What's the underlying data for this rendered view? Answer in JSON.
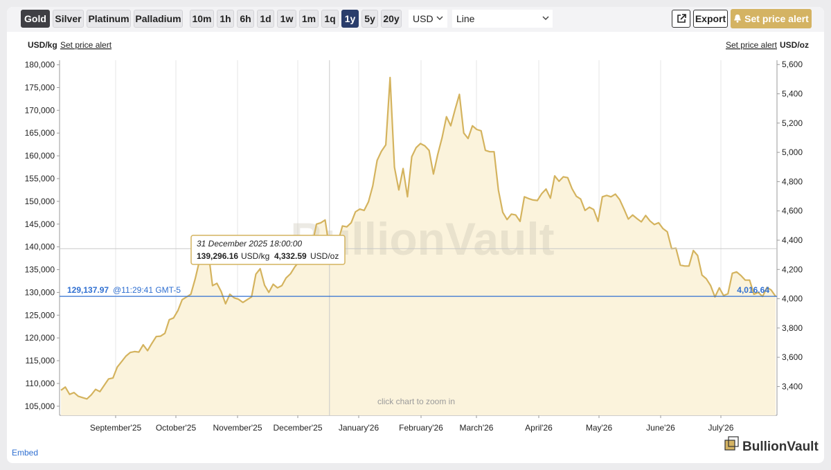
{
  "toolbar": {
    "metals": [
      "Gold",
      "Silver",
      "Platinum",
      "Palladium"
    ],
    "active_metal": "Gold",
    "ranges": [
      "10m",
      "1h",
      "6h",
      "1d",
      "1w",
      "1m",
      "1q",
      "1y",
      "5y",
      "20y"
    ],
    "active_range": "1y",
    "currency": "USD",
    "chart_style": "Line",
    "export_label": "Export",
    "alert_label": "Set price alert"
  },
  "left_unit": "USD/kg",
  "right_unit": "USD/oz",
  "set_alert_link": "Set price alert",
  "watermark": "BullionVault",
  "zoom_hint": "click chart to zoom in",
  "tooltip": {
    "date": "31 December 2025 18:00:00",
    "kg": "139,296.16",
    "kg_unit": "USD/kg",
    "oz": "4,332.59",
    "oz_unit": "USD/oz"
  },
  "current": {
    "kg": "129,137.97",
    "time": "@11:29:41 GMT-5",
    "oz": "4,016.64"
  },
  "embed_label": "Embed",
  "brand": "BullionVault",
  "colors": {
    "line": "#d4b35e",
    "fill": "#fbf3dc",
    "current_line": "#2f6fd1",
    "accent": "#d4b363"
  },
  "chart_data": {
    "type": "area",
    "title": "",
    "ylabel": "USD/kg",
    "y2label": "USD/oz",
    "ylim": [
      103000,
      181000
    ],
    "y2lim": [
      3203.5,
      5629.5
    ],
    "x_month_labels": [
      "September'25",
      "October'25",
      "November'25",
      "December'25",
      "January'26",
      "February'26",
      "March'26",
      "April'26",
      "May'26",
      "June'26",
      "July'26"
    ],
    "y_ticks": [
      "105,000",
      "110,000",
      "115,000",
      "120,000",
      "125,000",
      "130,000",
      "135,000",
      "140,000",
      "145,000",
      "150,000",
      "155,000",
      "160,000",
      "165,000",
      "170,000",
      "175,000",
      "180,000"
    ],
    "y2_ticks": [
      "3,400",
      "3,600",
      "3,800",
      "4,000",
      "4,200",
      "4,400",
      "4,600",
      "4,800",
      "5,000",
      "5,200",
      "5,400",
      "5,600"
    ],
    "series": [
      {
        "values": [
          108500,
          109200,
          107600,
          108000,
          107200,
          106900,
          106600,
          107500,
          108700,
          108200,
          109600,
          111000,
          111200,
          113600,
          114800,
          116000,
          116800,
          117000,
          116900,
          118500,
          117200,
          118800,
          120300,
          120400,
          121000,
          124000,
          124400,
          126000,
          128400,
          129000,
          129600,
          133000,
          137000,
          142000,
          139000,
          131500,
          132000,
          130200,
          127500,
          129600,
          128800,
          128500,
          127800,
          128400,
          129000,
          134000,
          135200,
          131600,
          130000,
          131800,
          131000,
          131500,
          133200,
          134100,
          135600,
          136800,
          138300,
          139000,
          140500,
          145000,
          145300,
          145900,
          139600,
          139300,
          141200,
          144600,
          144400,
          145300,
          147700,
          148300,
          148000,
          149900,
          153400,
          159000,
          161000,
          162400,
          177200,
          157500,
          152500,
          157200,
          151000,
          159800,
          161800,
          162700,
          162200,
          161200,
          156000,
          160300,
          164000,
          168600,
          166600,
          170200,
          173500,
          165000,
          163800,
          166600,
          165800,
          165500,
          161200,
          160900,
          160900,
          152500,
          147600,
          146000,
          147200,
          147000,
          145600,
          151000,
          150600,
          150300,
          150200,
          151700,
          152700,
          150700,
          155600,
          154400,
          155400,
          155200,
          152800,
          151100,
          150500,
          148000,
          148700,
          148200,
          145600,
          151000,
          151300,
          151000,
          151600,
          150400,
          148300,
          146100,
          147000,
          146200,
          145500,
          146900,
          145700,
          144900,
          145300,
          144000,
          143300,
          139600,
          139700,
          136000,
          135800,
          135800,
          139200,
          138100,
          133800,
          133000,
          131500,
          129000,
          131000,
          129300,
          129700,
          134200,
          134500,
          133700,
          132700,
          132700,
          129600,
          130000,
          129100,
          131100,
          130500,
          129138
        ]
      }
    ],
    "current_value": 129137.97,
    "tooltip_index": 62
  }
}
